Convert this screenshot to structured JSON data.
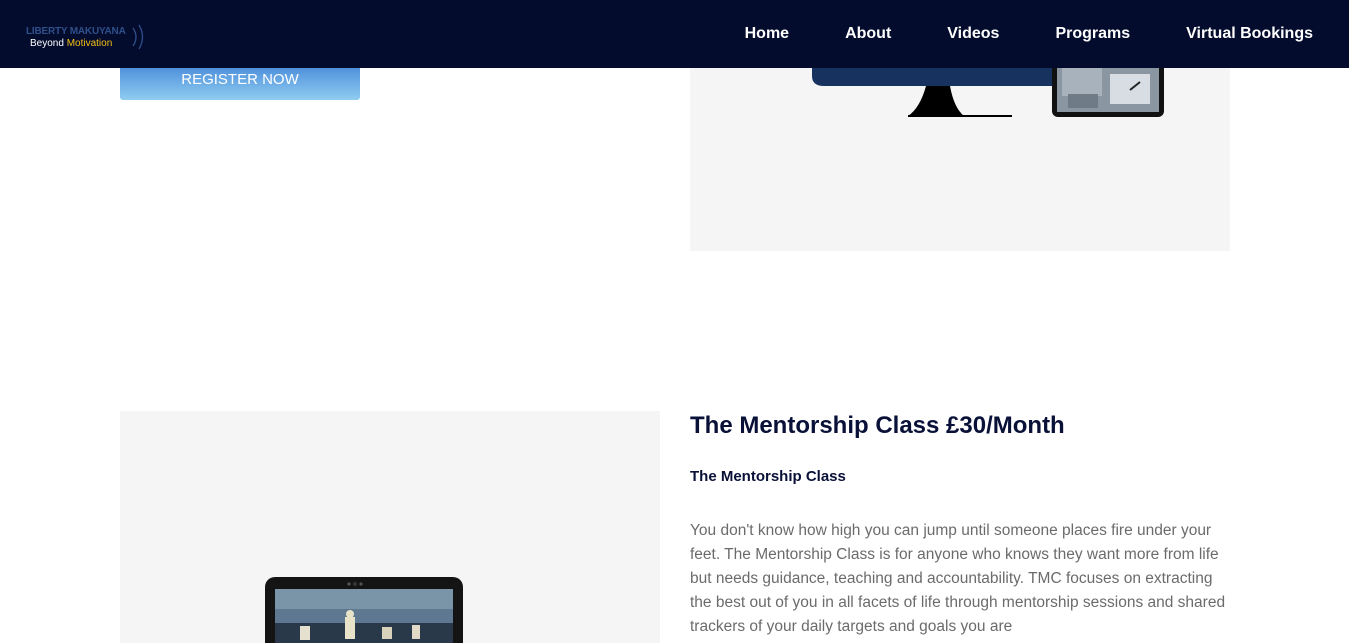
{
  "logo": {
    "line1": "LIBERTY MAKUYANA",
    "line2_prefix": "Beyond",
    "line2_accent": "Motivation"
  },
  "nav": {
    "items": [
      "Home",
      "About",
      "Videos",
      "Programs",
      "Virtual Bookings"
    ]
  },
  "hero": {
    "register_label": "REGISTER NOW"
  },
  "mentorship": {
    "title": "The Mentorship Class £30/Month",
    "subtitle": "The Mentorship Class",
    "description": "You don't know how high you can jump until someone places fire under your feet. The Mentorship Class is for anyone who knows they want more from life but needs guidance, teaching and accountability. TMC focuses on extracting the best out of you in all facets of life through mentorship sessions and shared trackers of your daily targets and goals you are"
  },
  "colors": {
    "navbar": "#040c2e",
    "accent_gold": "#f2c014",
    "button_top": "#3d7fd6",
    "button_bottom": "#8fcdf0",
    "heading": "#0a1138",
    "body_text": "#6b6b6b",
    "media_bg": "#f5f5f5"
  }
}
